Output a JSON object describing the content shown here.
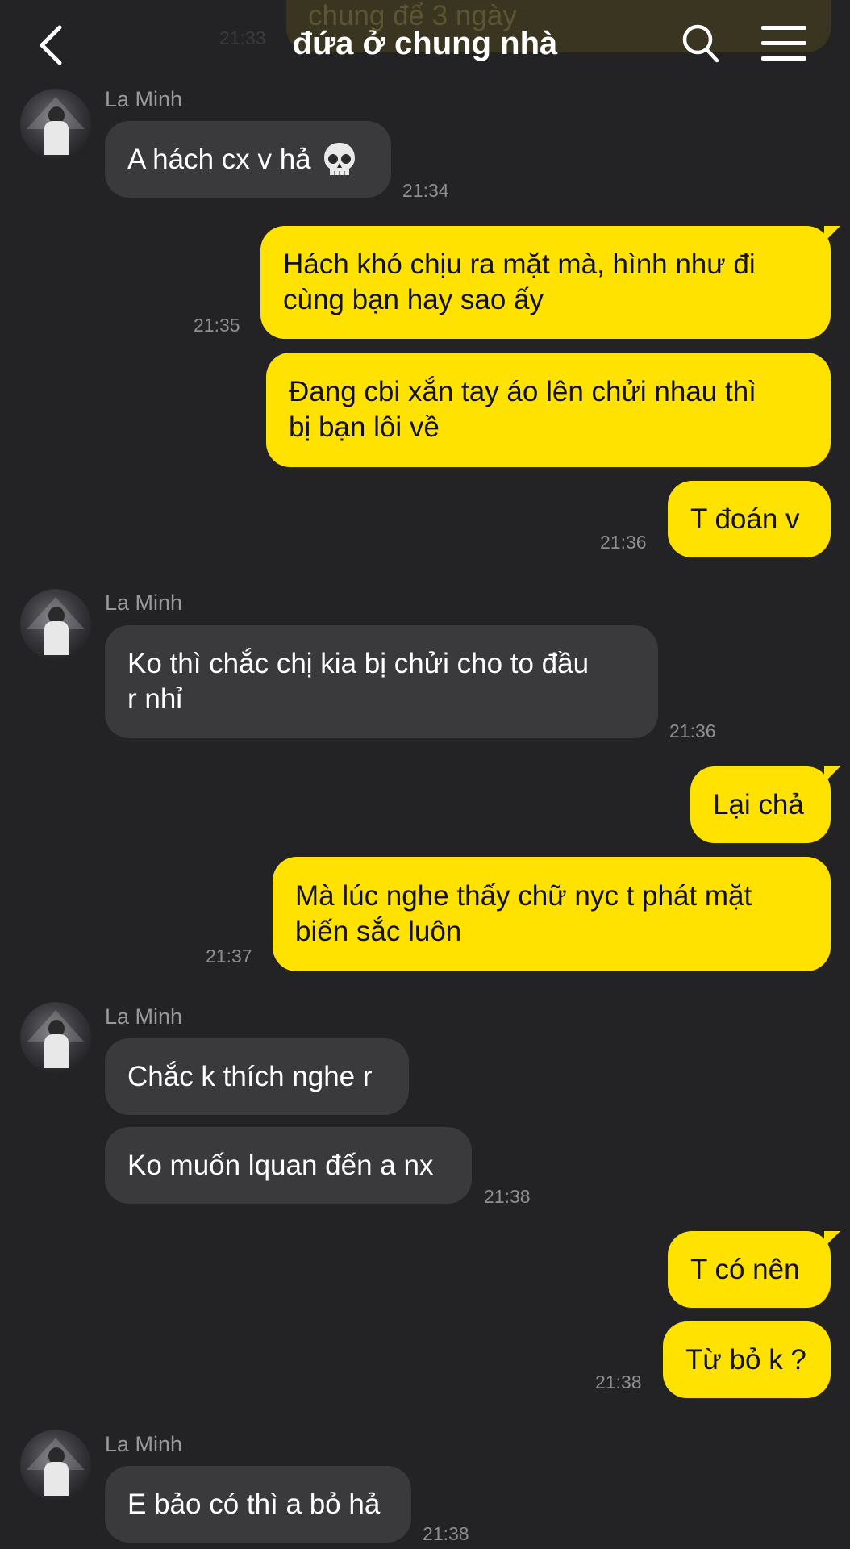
{
  "header": {
    "title": "đứa ở chung nhà",
    "ghost_text": "chung để 3 ngày",
    "ghost_time": "21:33"
  },
  "messages": [
    {
      "side": "in",
      "sender": "La Minh",
      "text": "A hách cx v hả",
      "emoji": "skull",
      "time": "21:34"
    },
    {
      "side": "out",
      "text": "Hách khó chịu ra mặt mà, hình như đi\ncùng bạn hay sao ấy",
      "time": "21:35"
    },
    {
      "side": "out",
      "text": "Đang cbi xắn tay áo lên chửi nhau thì\nbị bạn lôi về",
      "time": ""
    },
    {
      "side": "out",
      "text": "T đoán v",
      "time": "21:36"
    },
    {
      "side": "in",
      "sender": "La Minh",
      "text": "Ko thì chắc chị kia bị chửi cho to đầu\nr nhỉ",
      "time": "21:36"
    },
    {
      "side": "out",
      "text": "Lại chả",
      "time": ""
    },
    {
      "side": "out",
      "text": "Mà lúc nghe thấy chữ nyc t phát mặt\nbiến sắc luôn",
      "time": "21:37"
    },
    {
      "side": "in",
      "sender": "La Minh",
      "text": "Chắc k thích nghe r",
      "time": ""
    },
    {
      "side": "in",
      "text": "Ko muốn lquan đến a nx",
      "time": "21:38"
    },
    {
      "side": "out",
      "text": "T có nên",
      "time": ""
    },
    {
      "side": "out",
      "text": "Từ bỏ k ?",
      "time": "21:38"
    },
    {
      "side": "in",
      "sender": "La Minh",
      "text": "E bảo có thì a bỏ hả",
      "time": "21:38"
    }
  ]
}
